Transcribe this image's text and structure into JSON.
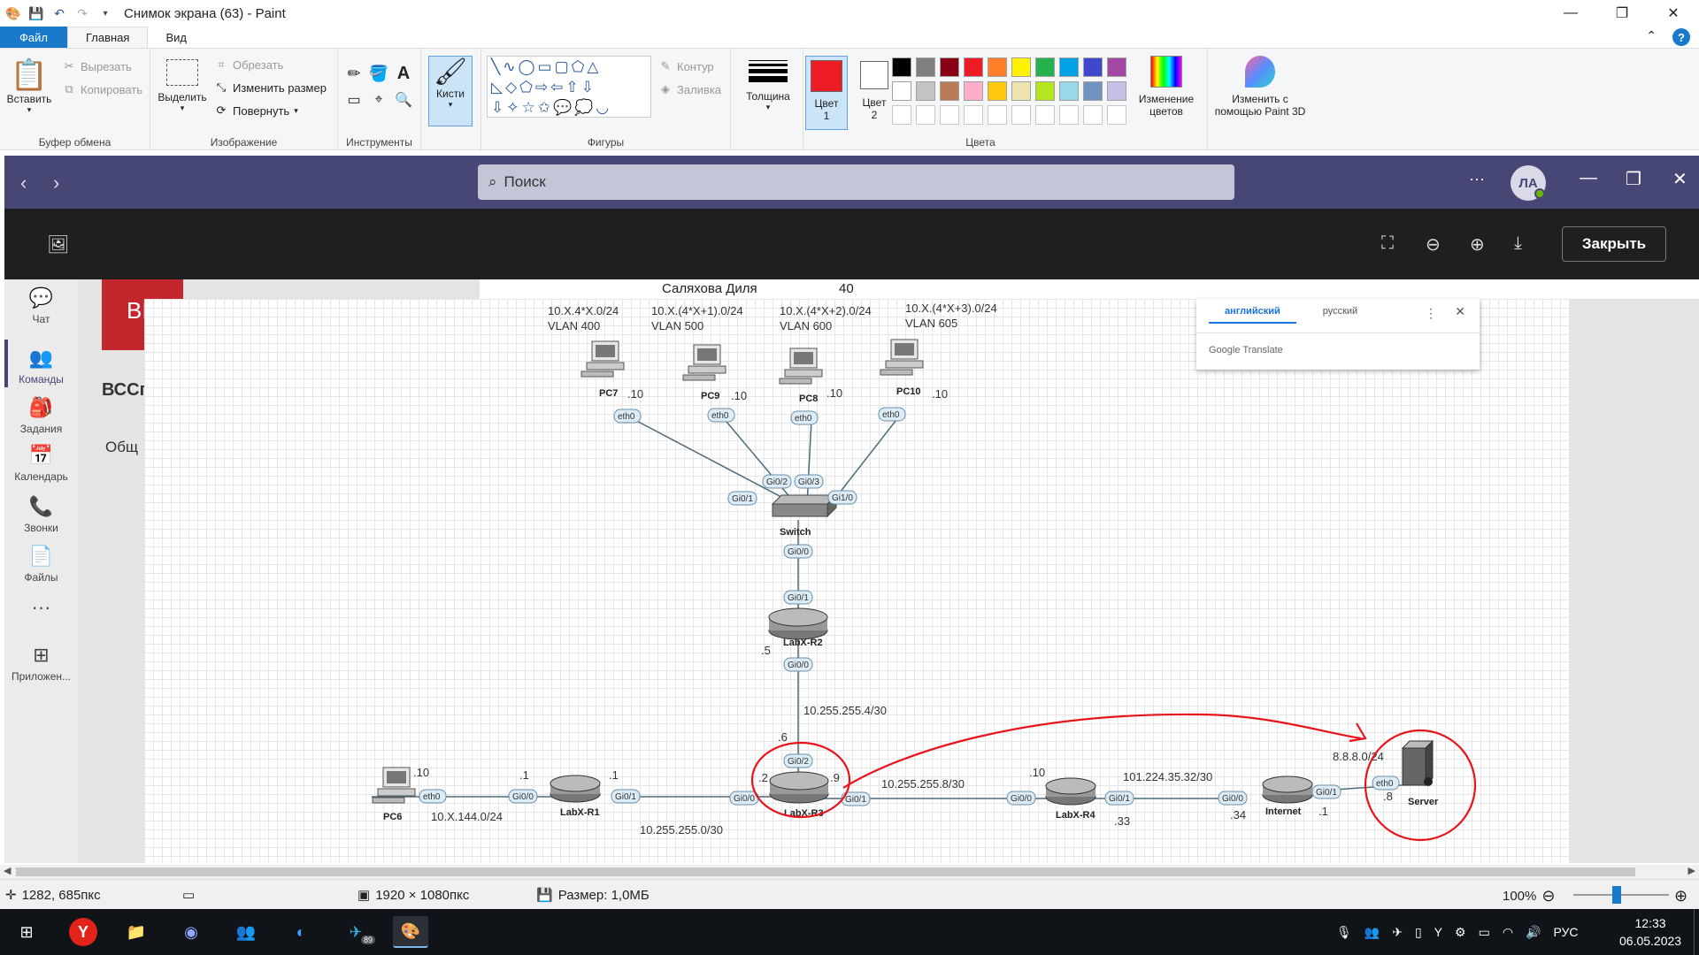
{
  "window": {
    "title": "Снимок экрана (63) - Paint",
    "minimize_icon": "—",
    "maximize_icon": "❐",
    "close_icon": "✕"
  },
  "menu": {
    "file": "Файл",
    "home": "Главная",
    "view": "Вид"
  },
  "ribbon": {
    "clipboard": {
      "paste": "Вставить",
      "cut": "Вырезать",
      "copy": "Копировать",
      "label": "Буфер обмена"
    },
    "image": {
      "select": "Выделить",
      "crop": "Обрезать",
      "resize": "Изменить размер",
      "rotate": "Повернуть",
      "label": "Изображение"
    },
    "tools": {
      "label": "Инструменты"
    },
    "brushes": {
      "label": "Кисти"
    },
    "shapes": {
      "outline": "Контур",
      "fill": "Заливка",
      "label": "Фигуры"
    },
    "size": {
      "label": "Толщина"
    },
    "color1": {
      "label": "Цвет 1",
      "line1": "Цвет",
      "line2": "1",
      "value": "#ed1c24"
    },
    "color2": {
      "label": "Цвет 2",
      "line1": "Цвет",
      "line2": "2",
      "value": "#ffffff"
    },
    "colors": {
      "label": "Цвета",
      "palette": [
        "#000000",
        "#7f7f7f",
        "#880015",
        "#ed1c24",
        "#ff7f27",
        "#fff200",
        "#22b14c",
        "#00a2e8",
        "#3f48cc",
        "#a349a4",
        "#ffffff",
        "#c3c3c3",
        "#b97a57",
        "#ffaec9",
        "#ffc90e",
        "#efe4b0",
        "#b5e61d",
        "#99d9ea",
        "#7092be",
        "#c8bfe7",
        "#ffffff",
        "#ffffff",
        "#ffffff",
        "#ffffff",
        "#ffffff",
        "#ffffff",
        "#ffffff",
        "#ffffff",
        "#ffffff",
        "#ffffff"
      ]
    },
    "edit_colors": {
      "line1": "Изменение",
      "line2": "цветов"
    },
    "paint3d": {
      "line1": "Изменить с",
      "line2": "помощью Paint 3D"
    }
  },
  "teams": {
    "search_placeholder": "Поиск",
    "avatar_initials": "ЛА",
    "more_icon": "···",
    "close_button": "Закрыть",
    "rail": [
      {
        "label": "Чат",
        "icon": "chat-icon",
        "glyph": "💬"
      },
      {
        "label": "Команды",
        "icon": "teams-icon",
        "glyph": "👥"
      },
      {
        "label": "Задания",
        "icon": "assignments-icon",
        "glyph": "🎒"
      },
      {
        "label": "Календарь",
        "icon": "calendar-icon",
        "glyph": "📅"
      },
      {
        "label": "Звонки",
        "icon": "calls-icon",
        "glyph": "📞"
      },
      {
        "label": "Файлы",
        "icon": "files-icon",
        "glyph": "📄"
      },
      {
        "label": "",
        "icon": "more-icon",
        "glyph": "···"
      },
      {
        "label": "Приложен...",
        "icon": "apps-icon",
        "glyph": "⊞"
      }
    ],
    "bg_red_text": "ВІ",
    "bg_heading": "ВССг",
    "bg_tab": "Общ",
    "bg_cell_name": "Саляхова Диля",
    "bg_cell_value": "40"
  },
  "translate": {
    "tab_source": "английский",
    "tab_target": "русский",
    "brand": "Google Translate"
  },
  "diagram": {
    "nets": [
      {
        "line1": "10.X.4*X.0/24",
        "line2": "VLAN 400"
      },
      {
        "line1": "10.X.(4*X+1).0/24",
        "line2": "VLAN 500"
      },
      {
        "line1": "10.X.(4*X+2).0/24",
        "line2": "VLAN 600"
      },
      {
        "line1": "10.X.(4*X+3).0/24",
        "line2": "VLAN 605"
      }
    ],
    "pcs": [
      {
        "name": "PC7",
        "host": ".10",
        "iface": "eth0"
      },
      {
        "name": "PC9",
        "host": ".10",
        "iface": "eth0"
      },
      {
        "name": "PC8",
        "host": ".10",
        "iface": "eth0"
      },
      {
        "name": "PC10",
        "host": ".10",
        "iface": "eth0"
      }
    ],
    "switch": {
      "name": "Switch",
      "ports": [
        "Gi0/1",
        "Gi0/2",
        "Gi0/3",
        "Gi1/0",
        "Gi0/0"
      ]
    },
    "r2": {
      "name": "LabX-R2",
      "up": "Gi0/1",
      "down": "Gi0/0",
      "host": ".5"
    },
    "r2_r3_net": "10.255.255.4/30",
    "r3": {
      "name": "LabX-R3",
      "up": "Gi0/2",
      "left": "Gi0/0",
      "right": "Gi0/1",
      "host_up": ".6",
      "host_left": ".2",
      "host_right": ".9"
    },
    "r1": {
      "name": "LabX-R1",
      "left": "Gi0/0",
      "right": "Gi0/1",
      "host_left": ".1",
      "host_right": ".1"
    },
    "pc6": {
      "name": "PC6",
      "iface": "eth0",
      "host": ".10"
    },
    "net_pc6": "10.X.144.0/24",
    "net_r1_r3": "10.255.255.0/30",
    "net_r3_r4": "10.255.255.8/30",
    "r4": {
      "name": "LabX-R4",
      "left": "Gi0/0",
      "right": "Gi0/1",
      "host_left": ".10",
      "host_right": ".33"
    },
    "net_r4_inet": "101.224.35.32/30",
    "internet": {
      "name": "Internet",
      "left": "Gi0/0",
      "right": "Gi0/1",
      "host_left": ".34",
      "host_right": ".1"
    },
    "server": {
      "name": "Server",
      "iface": "eth0",
      "host": ".8",
      "net": "8.8.8.0/24"
    },
    "annotation_color": "#e8141c"
  },
  "status": {
    "cursor": "1282, 685пкс",
    "dimensions": "1920 × 1080пкс",
    "size": "Размер: 1,0МБ",
    "zoom": "100%"
  },
  "taskbar": {
    "lang": "РУС",
    "time": "12:33",
    "date": "06.05.2023",
    "telegram_badge": "89"
  }
}
